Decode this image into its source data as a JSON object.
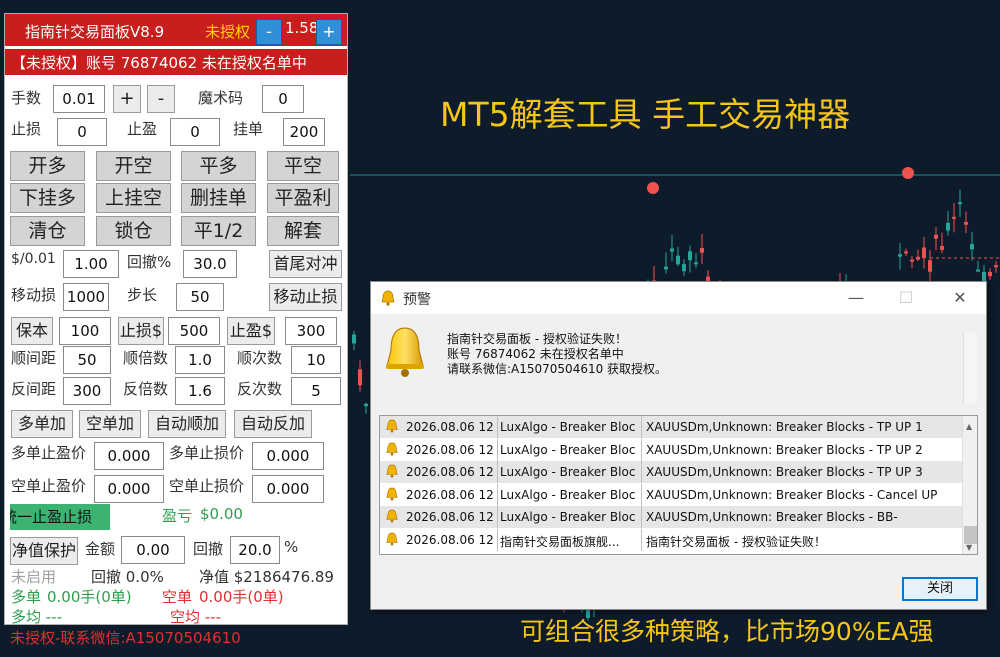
{
  "colors": {
    "accent": "#c81e1e",
    "headline": "#f5c518",
    "bull": "#26a69a",
    "bear": "#ef5350",
    "buy_blue": "#2f8fd8"
  },
  "headlines": {
    "top": "MT5解套工具 手工交易神器",
    "bottom": "可组合很多种策略，比市场90%EA强"
  },
  "panel": {
    "title": "指南针交易面板V8.9",
    "license_status": "未授权",
    "lot_display": "1.58",
    "minus_label": "-",
    "plus_label": "+",
    "banner": "【未授权】账号 76874062 未在授权名单中",
    "lots_label": "手数",
    "lots_value": "0.01",
    "magic_label": "魔术码",
    "magic_value": "0",
    "sl_label": "止损",
    "sl_value": "0",
    "tp_label": "止盈",
    "tp_value": "0",
    "pending_label": "挂单",
    "pending_value": "200",
    "buttons": {
      "open_long": "开多",
      "open_short": "开空",
      "close_long": "平多",
      "close_short": "平空",
      "buy_limit": "下挂多",
      "sell_limit": "上挂空",
      "delete_pending": "删挂单",
      "close_profit": "平盈利",
      "clear": "清仓",
      "lock": "锁仓",
      "close_half": "平1/2",
      "unlock": "解套"
    },
    "per_001_label": "$/0.01",
    "per_001_value": "1.00",
    "pullback_label": "回撤%",
    "pullback_value": "30.0",
    "hedge_btn": "首尾对冲",
    "trail_label": "移动损",
    "trail_value": "1000",
    "step_label": "步长",
    "step_value": "50",
    "trail_btn": "移动止损",
    "breakeven_btn": "保本",
    "breakeven_value": "100",
    "sl_money_btn": "止损$",
    "sl_money_value": "500",
    "tp_money_btn": "止盈$",
    "tp_money_value": "300",
    "fwd_gap_label": "顺间距",
    "fwd_gap_value": "50",
    "fwd_mult_label": "顺倍数",
    "fwd_mult_value": "1.0",
    "fwd_count_label": "顺次数",
    "fwd_count_value": "10",
    "rev_gap_label": "反间距",
    "rev_gap_value": "300",
    "rev_mult_label": "反倍数",
    "rev_mult_value": "1.6",
    "rev_count_label": "反次数",
    "rev_count_value": "5",
    "add_long_btn": "多单加",
    "add_short_btn": "空单加",
    "auto_fwd_btn": "自动顺加",
    "auto_rev_btn": "自动反加",
    "long_tp_label": "多单止盈价",
    "long_tp_value": "0.000",
    "long_sl_label": "多单止损价",
    "long_sl_value": "0.000",
    "short_tp_label": "空单止盈价",
    "short_tp_value": "0.000",
    "short_sl_label": "空单止损价",
    "short_sl_value": "0.000",
    "unified_tp_btn": "统一止盈止损",
    "pnl_label": "盈亏",
    "pnl_value": "$0.00",
    "equity_protect_btn": "净值保护",
    "amount_label": "金额",
    "amount_value": "0.00",
    "drawdown_label": "回撤",
    "drawdown_value": "20.0",
    "percent_sign": "%",
    "not_enabled": "未启用",
    "drawdown_status": "回撤 0.0%",
    "equity_status": "净值 $2186476.89",
    "long_summary_label": "多单",
    "long_summary_value": "0.00手(0单)",
    "short_summary_label": "空单",
    "short_summary_value": "0.00手(0单)",
    "long_avg": "多均 ---",
    "short_avg": "空均 ---",
    "footer": "未授权-联系微信:A15070504610"
  },
  "dialog": {
    "title": "预警",
    "minimize": "—",
    "maximize": "☐",
    "close": "✕",
    "message_line1": "指南针交易面板 - 授权验证失败！",
    "message_line2": "账号 76874062 未在授权名单中",
    "message_line3": "请联系微信:A15070504610 获取授权。",
    "rows": [
      {
        "time": "2026.08.06 12...",
        "source": "LuxAlgo - Breaker Block...",
        "message": "XAUUSDm,Unknown: Breaker Blocks - TP UP 1"
      },
      {
        "time": "2026.08.06 12...",
        "source": "LuxAlgo - Breaker Block...",
        "message": "XAUUSDm,Unknown: Breaker Blocks - TP UP 2"
      },
      {
        "time": "2026.08.06 12...",
        "source": "LuxAlgo - Breaker Block...",
        "message": "XAUUSDm,Unknown: Breaker Blocks - TP UP 3"
      },
      {
        "time": "2026.08.06 12...",
        "source": "LuxAlgo - Breaker Block...",
        "message": "XAUUSDm,Unknown: Breaker Blocks - Cancel UP"
      },
      {
        "time": "2026.08.06 12...",
        "source": "LuxAlgo - Breaker Block...",
        "message": "XAUUSDm,Unknown: Breaker Blocks - BB-"
      },
      {
        "time": "2026.08.06 12...",
        "source": "指南针交易面板旗舰...",
        "message": "指南针交易面板 - 授权验证失败！"
      }
    ],
    "close_btn": "关闭"
  }
}
